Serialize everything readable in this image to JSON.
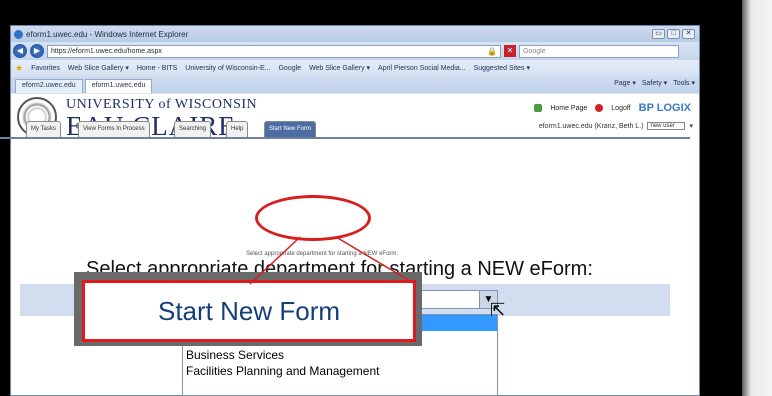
{
  "browser": {
    "title": "eform1.uwec.edu - Windows Internet Explorer",
    "url": "https://eform1.uwec.edu/home.aspx",
    "search_placeholder": "Google",
    "favorites_label": "Favorites",
    "favorites": [
      "Web Slice Gallery ▾",
      "Home - BITS",
      "University of Wisconsin-E...",
      "Google",
      "Web Slice Gallery ▾",
      "April Pierson Social Media...",
      "Suggested Sites ▾"
    ],
    "tabs": [
      "eform2.uwec.edu",
      "eform1.uwec.edu"
    ],
    "commands": [
      "Page ▾",
      "Safety ▾",
      "Tools ▾"
    ]
  },
  "header": {
    "university_small": "UNIVERSITY of WISCONSIN",
    "university_big": "EAU CLAIRE",
    "home_link": "Home Page",
    "logoff_link": "Logoff",
    "brand": "BP LOGIX",
    "user_line": "eform1.uwec.edu (Kranz, Beth L.)",
    "user_select": "new user"
  },
  "form_tabs": [
    "My Tasks",
    "View Forms In Process",
    "Searching",
    "Help",
    "Start New Form"
  ],
  "content": {
    "hint": "Select appropriate department for starting a NEW eForm:",
    "prompt": "Select appropriate department for starting a NEW eForm:",
    "dropdown_options": [
      "Academic Affairs",
      "Business Services",
      "Facilities Planning and Management"
    ]
  },
  "callout": {
    "text": "Start New Form"
  },
  "colors": {
    "accent_red": "#e01a1a",
    "callout_text": "#143f7a",
    "selected_tab": "#4c6ca4"
  }
}
